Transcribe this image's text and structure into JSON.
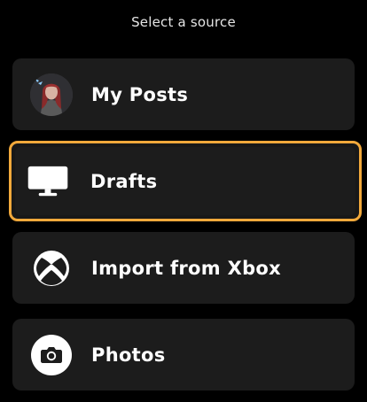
{
  "header": {
    "title": "Select a source"
  },
  "sources": [
    {
      "label": "My Posts",
      "icon": "avatar"
    },
    {
      "label": "Drafts",
      "icon": "monitor-icon",
      "selected": true
    },
    {
      "label": "Import from Xbox",
      "icon": "xbox-icon"
    },
    {
      "label": "Photos",
      "icon": "camera-icon"
    }
  ],
  "colors": {
    "background": "#000000",
    "card": "#1c1c1c",
    "selection_border": "#f2a93b",
    "text": "#ffffff"
  }
}
